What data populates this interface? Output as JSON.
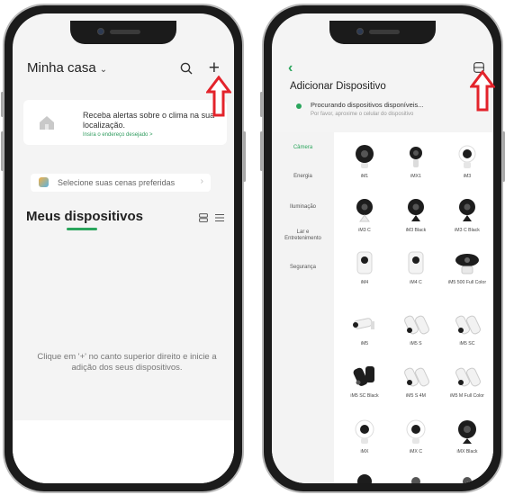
{
  "left_phone": {
    "home_title": "Minha casa",
    "weather_text": "Receba alertas sobre o clima na sua localização.",
    "weather_link": "Insira o endereço desejado  >",
    "scenes_text": "Selecione suas cenas preferidas",
    "devices_title": "Meus dispositivos",
    "empty_message": "Clique em '+' no canto superior direito e inicie a adição dos seus dispositivos."
  },
  "right_phone": {
    "title": "Adicionar Dispositivo",
    "searching": "Procurando dispositivos disponíveis...",
    "searching_sub": "Por favor, aproxime o celular do dispositivo",
    "categories": [
      "Câmera",
      "Energia",
      "Iluminação",
      "Lar e Entretenimento",
      "Segurança"
    ],
    "active_category": "Câmera",
    "products": [
      {
        "label": "iM1",
        "icon": "dome-camera"
      },
      {
        "label": "iMX1",
        "icon": "mini-camera"
      },
      {
        "label": "iM3",
        "icon": "dome-camera"
      },
      {
        "label": "iM3 C",
        "icon": "stand-camera"
      },
      {
        "label": "iM3 Black",
        "icon": "stand-camera-black"
      },
      {
        "label": "iM3 C Black",
        "icon": "stand-camera-black"
      },
      {
        "label": "iM4",
        "icon": "cube-camera"
      },
      {
        "label": "iM4 C",
        "icon": "cube-camera"
      },
      {
        "label": "iM5 500 Full Color",
        "icon": "pan-tilt-camera"
      },
      {
        "label": "iM5",
        "icon": "bullet-camera"
      },
      {
        "label": "iM5 S",
        "icon": "bullet-camera"
      },
      {
        "label": "iM5 SC",
        "icon": "bullet-camera"
      },
      {
        "label": "iM5 SC Black",
        "icon": "bullet-camera-black"
      },
      {
        "label": "iM5 S 4M",
        "icon": "bullet-camera"
      },
      {
        "label": "iM5 M Full Color",
        "icon": "bullet-camera"
      },
      {
        "label": "iMX",
        "icon": "dome-camera"
      },
      {
        "label": "iMX C",
        "icon": "dome-camera"
      },
      {
        "label": "iMX Black",
        "icon": "dome-camera-black"
      }
    ]
  },
  "colors": {
    "accent_green": "#2aa55c",
    "annotation_red": "#e3232b"
  }
}
